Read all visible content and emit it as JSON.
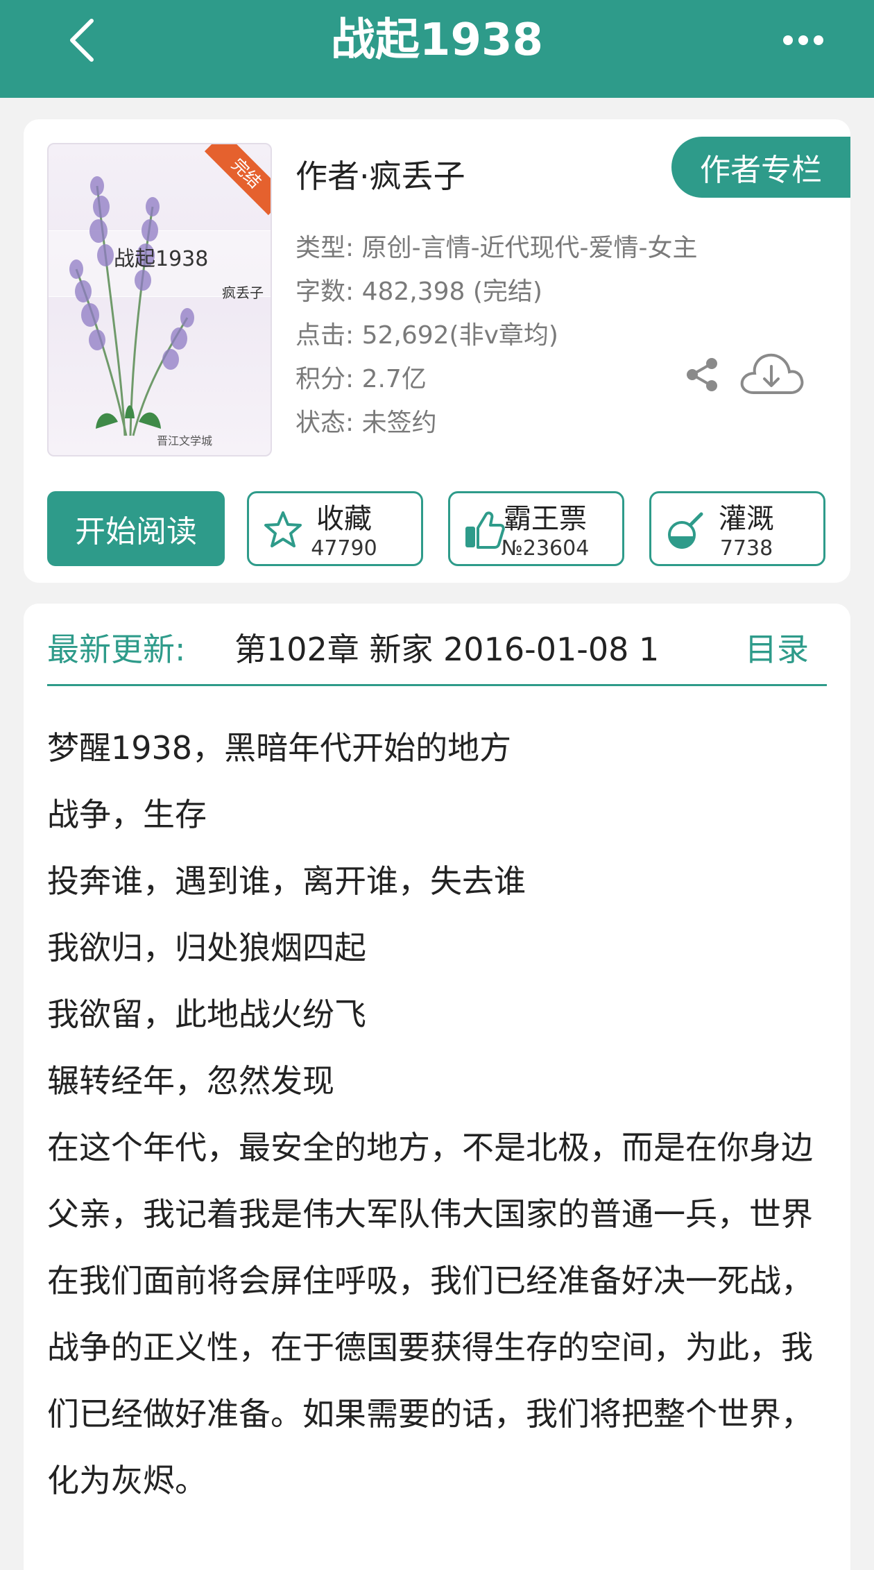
{
  "header": {
    "title": "战起1938",
    "back_icon": "chevron-left-icon",
    "more_icon": "more-dots-icon"
  },
  "book": {
    "cover": {
      "title": "战起1938",
      "author": "疯丢子",
      "ribbon": "完结",
      "logo": "晋江文学城"
    },
    "author_line": "作者·疯丢子",
    "author_column_button": "作者专栏",
    "meta": {
      "type": "类型: 原创-言情-近代现代-爱情-女主",
      "words": "字数: 482,398 (完结)",
      "clicks": "点击: 52,692(非v章均)",
      "score": "积分: 2.7亿",
      "status": "状态: 未签约"
    },
    "icons": {
      "share": "share-icon",
      "download": "cloud-download-icon"
    }
  },
  "actions": {
    "start_reading": "开始阅读",
    "collect": {
      "label": "收藏",
      "count": "47790",
      "icon": "star-icon"
    },
    "vote": {
      "label": "霸王票",
      "count": "№23604",
      "icon": "thumbs-up-icon"
    },
    "nourish": {
      "label": "灌溉",
      "count": "7738",
      "icon": "watering-flask-icon"
    }
  },
  "latest": {
    "label": "最新更新:",
    "chapter": "第102章  新家  2016-01-08 1",
    "toc": "目录"
  },
  "intro": {
    "lines": [
      "梦醒1938，黑暗年代开始的地方",
      "战争，生存",
      "投奔谁，遇到谁，离开谁，失去谁",
      "我欲归，归处狼烟四起",
      "我欲留，此地战火纷飞",
      "辗转经年，忽然发现",
      "在这个年代，最安全的地方，不是北极，而是在你身边",
      "父亲，我记着我是伟大军队伟大国家的普通一兵，世界在我们面前将会屏住呼吸，我们已经准备好决一死战，战争的正义性，在于德国要获得生存的空间，为此，我们已经做好准备。如果需要的话，我们将把整个世界，化为灰烬。"
    ]
  },
  "colors": {
    "accent": "#2e9b8a",
    "ribbon": "#e5612e",
    "meta_text": "#7a7a7a"
  }
}
